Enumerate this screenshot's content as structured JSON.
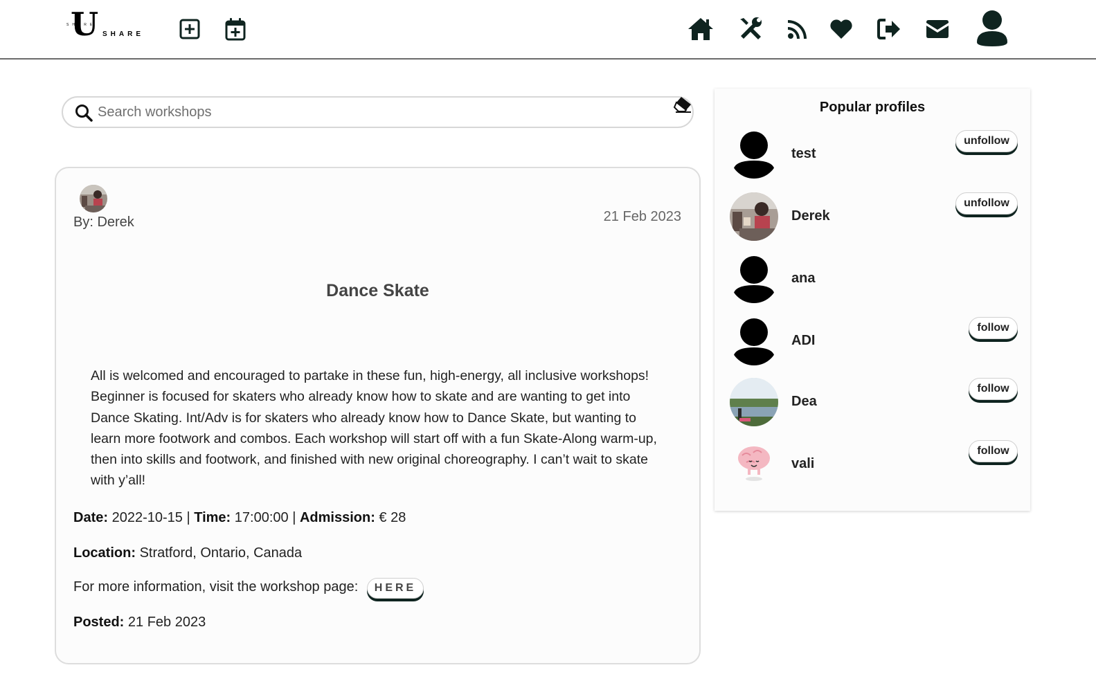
{
  "brand": {
    "logo_big": "U",
    "logo_small": "SHARE",
    "logo_word": "SHARE"
  },
  "nav": {
    "icons": [
      "add-workshop-icon",
      "add-event-icon",
      "home-icon",
      "tools-icon",
      "rss-icon",
      "heart-icon",
      "logout-icon",
      "mail-icon",
      "user-icon"
    ]
  },
  "search": {
    "placeholder": "Search workshops",
    "value": ""
  },
  "workshop": {
    "by": "By: Derek",
    "date": "21 Feb 2023",
    "title": "Dance Skate",
    "description": "All is welcomed and encouraged to partake in these fun, high-energy, all inclusive workshops! Beginner is focused for skaters who already know how to skate and are wanting to get into Dance Skating. Int/Adv is for skaters who already know how to Dance Skate, but wanting to learn more footwork and combos. Each workshop will start off with a fun Skate-Along warm-up, then into skills and footwork, and finished with new original choreography. I can’t wait to skate with y’all!",
    "date_label": "Date:",
    "date_value": "2022-10-15",
    "sep": "|",
    "time_label": "Time:",
    "time_value": "17:00:00",
    "admission_label": "Admission:",
    "admission_value": "€ 28",
    "location_label": "Location:",
    "location_value": "Stratford, Ontario, Canada",
    "more_info_text": "For more information, visit the workshop page:",
    "here_label": "HERE",
    "posted_label": "Posted:",
    "posted_value": "21 Feb 2023"
  },
  "popular": {
    "title": "Popular profiles",
    "profiles": [
      {
        "name": "test",
        "button": "unfollow"
      },
      {
        "name": "Derek",
        "button": "unfollow"
      },
      {
        "name": "ana",
        "button": ""
      },
      {
        "name": "ADI",
        "button": "follow"
      },
      {
        "name": "Dea",
        "button": "follow"
      },
      {
        "name": "vali",
        "button": "follow"
      }
    ]
  },
  "colors": {
    "accent_dark": "#0f2420",
    "border": "#d7d7d7",
    "text": "#222222"
  }
}
